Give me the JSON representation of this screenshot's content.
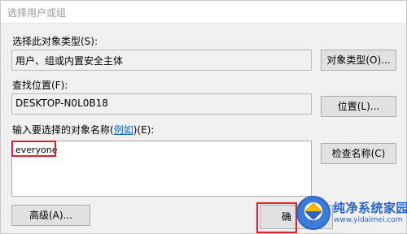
{
  "window": {
    "title": "选择用户或组"
  },
  "object_type": {
    "label": "选择此对象类型(S):",
    "value": "用户、组或内置安全主体",
    "button": "对象类型(O)..."
  },
  "location": {
    "label": "查找位置(F):",
    "value": "DESKTOP-N0L0B18",
    "button": "位置(L)..."
  },
  "names": {
    "label_prefix": "输入要选择的对象名称(",
    "label_link": "例如",
    "label_suffix": ")(E):",
    "value": "everyone",
    "check_button": "检查名称(C)"
  },
  "footer": {
    "advanced_button": "高级(A)...",
    "ok_button_partial": "确"
  },
  "watermark": {
    "site_name": "纯净系统家园",
    "url": "www.yidaimei.com"
  },
  "colors": {
    "highlight": "#e0212b",
    "link": "#0066cc",
    "dialog_bg": "#f0f0f0"
  }
}
